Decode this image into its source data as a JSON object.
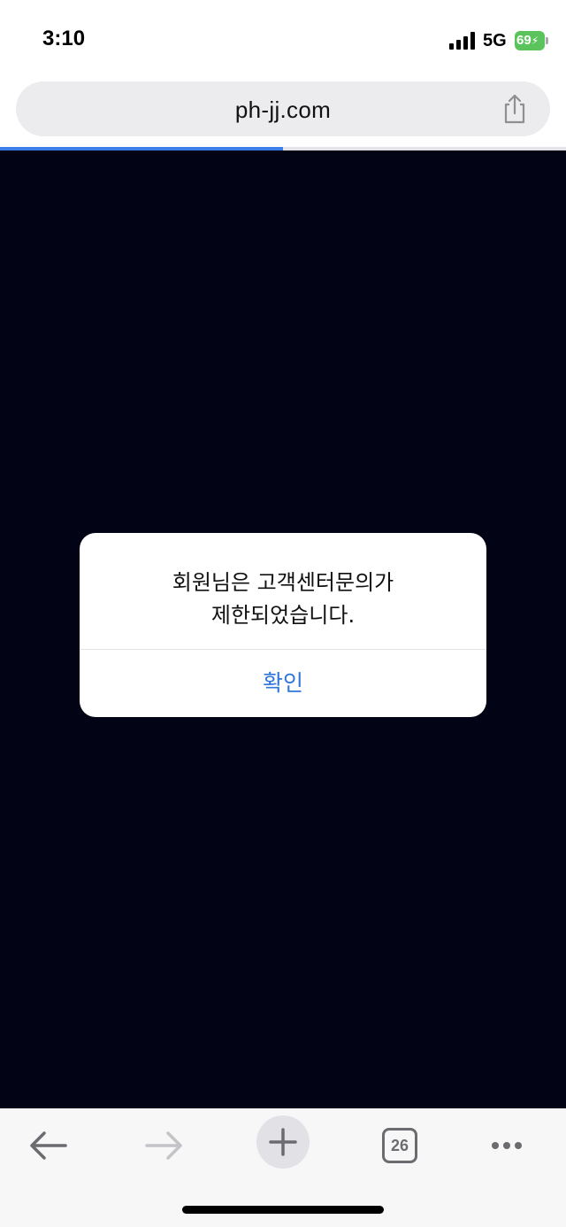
{
  "status_bar": {
    "time": "3:10",
    "network": "5G",
    "battery_percent": "69",
    "battery_charging": true,
    "battery_color": "#5bc35b",
    "signal_icon": "cellular-signal-icon"
  },
  "address_bar": {
    "url": "ph-jj.com",
    "share_icon": "share-icon"
  },
  "page_load_progress": 0.5,
  "web_content": {
    "background_color": "#020314"
  },
  "alert": {
    "message_line1": "회원님은 고객센터문의가",
    "message_line2": "제한되었습니다.",
    "confirm_label": "확인",
    "accent_color": "#2f76d8"
  },
  "toolbar": {
    "back_icon": "arrow-left-icon",
    "forward_icon": "arrow-right-icon",
    "new_tab_icon": "plus-icon",
    "tab_count": "26",
    "more_icon": "more-dots-icon"
  }
}
